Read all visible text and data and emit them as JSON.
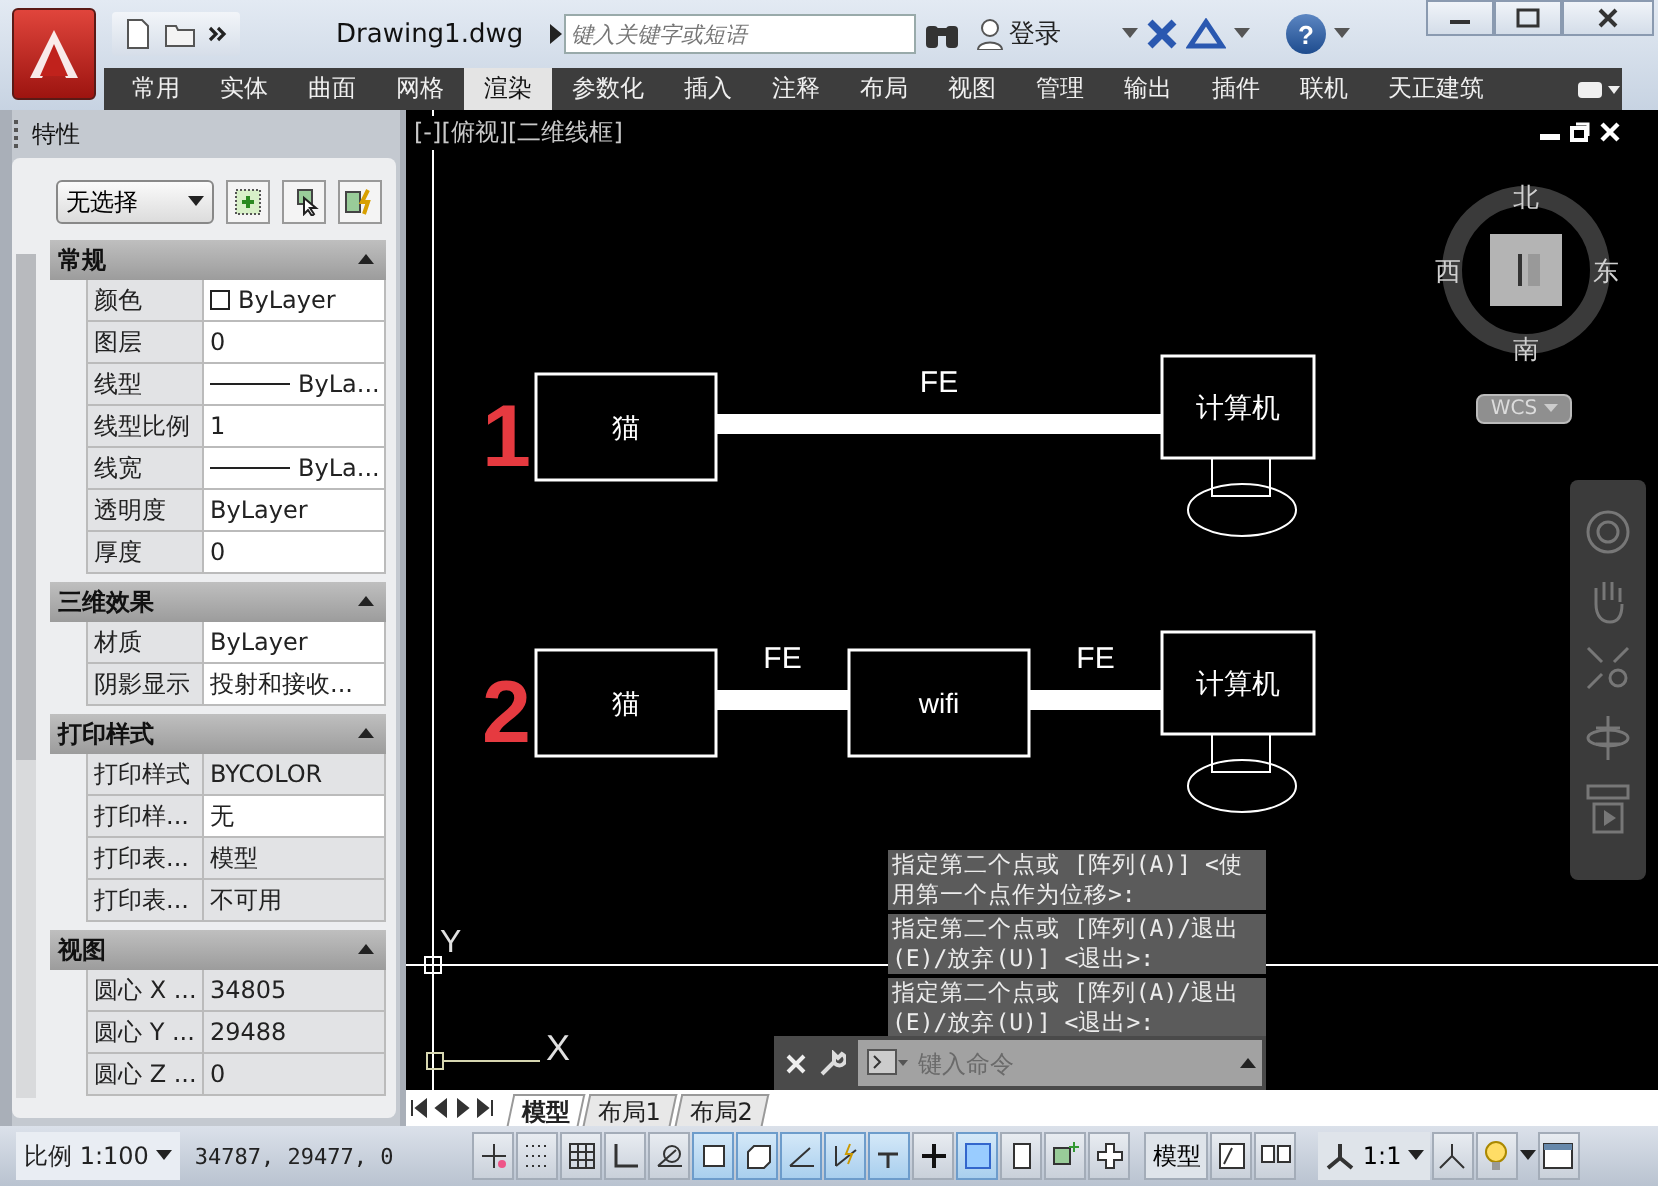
{
  "window": {
    "title": "Drawing1.dwg",
    "search_placeholder": "键入关键字或短语",
    "sign_in": "登录",
    "help": "?"
  },
  "ribbon_tabs": [
    {
      "label": "常用",
      "selected": false
    },
    {
      "label": "实体",
      "selected": false
    },
    {
      "label": "曲面",
      "selected": false
    },
    {
      "label": "网格",
      "selected": false
    },
    {
      "label": "渲染",
      "selected": true
    },
    {
      "label": "参数化",
      "selected": false
    },
    {
      "label": "插入",
      "selected": false
    },
    {
      "label": "注释",
      "selected": false
    },
    {
      "label": "布局",
      "selected": false
    },
    {
      "label": "视图",
      "selected": false
    },
    {
      "label": "管理",
      "selected": false
    },
    {
      "label": "输出",
      "selected": false
    },
    {
      "label": "插件",
      "selected": false
    },
    {
      "label": "联机",
      "selected": false
    },
    {
      "label": "天正建筑",
      "selected": false
    }
  ],
  "properties": {
    "title": "特性",
    "selection": "无选择",
    "sections": [
      {
        "title": "常规",
        "expanded": true,
        "rows": [
          {
            "label": "颜色",
            "value": "ByLayer",
            "kind": "color",
            "editable": true
          },
          {
            "label": "图层",
            "value": "0",
            "kind": "text",
            "editable": true
          },
          {
            "label": "线型",
            "value": "ByLa...",
            "kind": "line",
            "editable": true
          },
          {
            "label": "线型比例",
            "value": "1",
            "kind": "text",
            "editable": true
          },
          {
            "label": "线宽",
            "value": "ByLa...",
            "kind": "line",
            "editable": true
          },
          {
            "label": "透明度",
            "value": "ByLayer",
            "kind": "text",
            "editable": true
          },
          {
            "label": "厚度",
            "value": "0",
            "kind": "text",
            "editable": true
          }
        ]
      },
      {
        "title": "三维效果",
        "expanded": true,
        "rows": [
          {
            "label": "材质",
            "value": "ByLayer",
            "kind": "text",
            "editable": true
          },
          {
            "label": "阴影显示",
            "value": "投射和接收...",
            "kind": "text",
            "editable": true
          }
        ]
      },
      {
        "title": "打印样式",
        "expanded": true,
        "rows": [
          {
            "label": "打印样式",
            "value": "BYCOLOR",
            "kind": "text",
            "editable": false
          },
          {
            "label": "打印样...",
            "value": "无",
            "kind": "text",
            "editable": true
          },
          {
            "label": "打印表...",
            "value": "模型",
            "kind": "text",
            "editable": false
          },
          {
            "label": "打印表...",
            "value": "不可用",
            "kind": "text",
            "editable": false
          }
        ]
      },
      {
        "title": "视图",
        "expanded": true,
        "rows": [
          {
            "label": "圆心 X ...",
            "value": "34805",
            "kind": "text",
            "editable": false
          },
          {
            "label": "圆心 Y ...",
            "value": "29488",
            "kind": "text",
            "editable": false
          },
          {
            "label": "圆心 Z ...",
            "value": "0",
            "kind": "text",
            "editable": false
          }
        ]
      }
    ]
  },
  "viewport": {
    "label": "[-][俯视][二维线框]",
    "compass": {
      "north": "北",
      "south": "南",
      "west": "西",
      "east": "东"
    },
    "ucs_button": "WCS",
    "axes": {
      "x": "X",
      "y": "Y"
    }
  },
  "diagram": {
    "rows": [
      {
        "marker": "1",
        "nodes": [
          {
            "label": "猫",
            "kind": "box"
          },
          {
            "label": "计算机",
            "kind": "computer"
          }
        ],
        "links": [
          "FE"
        ]
      },
      {
        "marker": "2",
        "nodes": [
          {
            "label": "猫",
            "kind": "box"
          },
          {
            "label": "wifi",
            "kind": "box"
          },
          {
            "label": "计算机",
            "kind": "computer"
          }
        ],
        "links": [
          "FE",
          "FE"
        ]
      }
    ]
  },
  "command": {
    "history": [
      "指定第二个点或 [阵列(A)] <使用第一个点作为位移>:",
      "指定第二个点或 [阵列(A)/退出(E)/放弃(U)] <退出>:",
      "指定第二个点或 [阵列(A)/退出(E)/放弃(U)] <退出>:"
    ],
    "placeholder": "键入命令"
  },
  "layout_tabs": [
    {
      "label": "模型",
      "selected": true
    },
    {
      "label": "布局1",
      "selected": false
    },
    {
      "label": "布局2",
      "selected": false
    }
  ],
  "status_bar": {
    "scale": "比例 1:100",
    "coordinates": "34787, 29477, 0",
    "toggles": [
      {
        "kind": "infer",
        "on": false
      },
      {
        "kind": "snap",
        "on": false
      },
      {
        "kind": "grid",
        "on": false
      },
      {
        "kind": "ortho",
        "on": false
      },
      {
        "kind": "polar",
        "on": false
      },
      {
        "kind": "osnap",
        "on": true
      },
      {
        "kind": "osnap3d",
        "on": true
      },
      {
        "kind": "otrack",
        "on": true
      },
      {
        "kind": "ducs",
        "on": true
      },
      {
        "kind": "dyn",
        "on": true
      },
      {
        "kind": "lwt",
        "on": false
      },
      {
        "kind": "tpy",
        "on": true
      },
      {
        "kind": "qp",
        "on": false
      },
      {
        "kind": "sc",
        "on": false
      },
      {
        "kind": "am",
        "on": false
      }
    ],
    "space": "模型",
    "annotation_scale": "1:1"
  }
}
